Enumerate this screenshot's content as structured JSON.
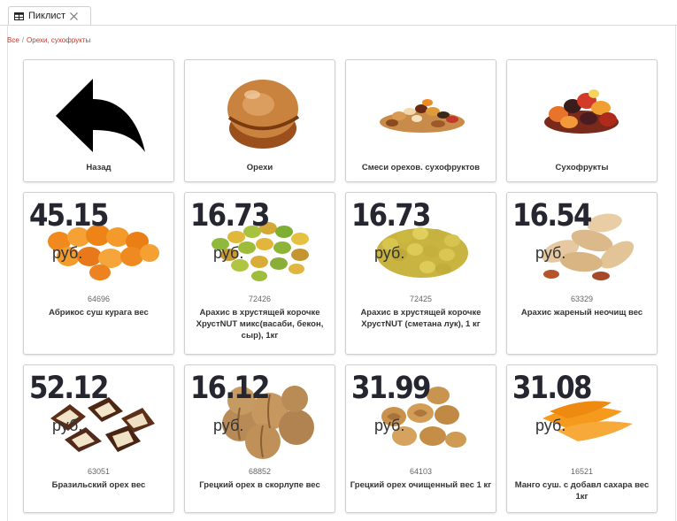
{
  "tab": {
    "icon": "table-icon",
    "label": "Пиклист",
    "close_icon": "close-icon"
  },
  "breadcrumb": {
    "root": "Все",
    "separator": "/",
    "current": "Орехи, сухофрукты"
  },
  "categories": [
    {
      "name": "Назад",
      "icon": "back-arrow-icon"
    },
    {
      "name": "Орехи",
      "icon": "hazelnut-image"
    },
    {
      "name": "Смеси орехов. сухофруктов",
      "icon": "nut-mix-image"
    },
    {
      "name": "Сухофрукты",
      "icon": "dried-fruit-image"
    }
  ],
  "currency": "руб.",
  "products": [
    {
      "price": "45.15",
      "code": "64696",
      "name": "Абрикос суш курага вес",
      "icon": "dried-apricot-image"
    },
    {
      "price": "16.73",
      "code": "72426",
      "name": "Арахис в хрустящей корочке ХрустNUT микс(васаби, бекон, сыр), 1кг",
      "icon": "coated-peanut-mix-image"
    },
    {
      "price": "16.73",
      "code": "72425",
      "name": "Арахис в хрустящей корочке ХрустNUT (сметана лук), 1 кг",
      "icon": "coated-peanut-image"
    },
    {
      "price": "16.54",
      "code": "63329",
      "name": "Арахис жареный неочищ вес",
      "icon": "peanut-shell-image"
    },
    {
      "price": "52.12",
      "code": "63051",
      "name": "Бразильский орех вес",
      "icon": "brazil-nut-image"
    },
    {
      "price": "16.12",
      "code": "68852",
      "name": "Грецкий орех в скорлупе вес",
      "icon": "walnut-shell-image"
    },
    {
      "price": "31.99",
      "code": "64103",
      "name": "Грецкий орех очищенный вес 1 кг",
      "icon": "walnut-kernel-image"
    },
    {
      "price": "31.08",
      "code": "16521",
      "name": "Манго суш. с добавл сахара вес 1кг",
      "icon": "dried-mango-image"
    }
  ]
}
